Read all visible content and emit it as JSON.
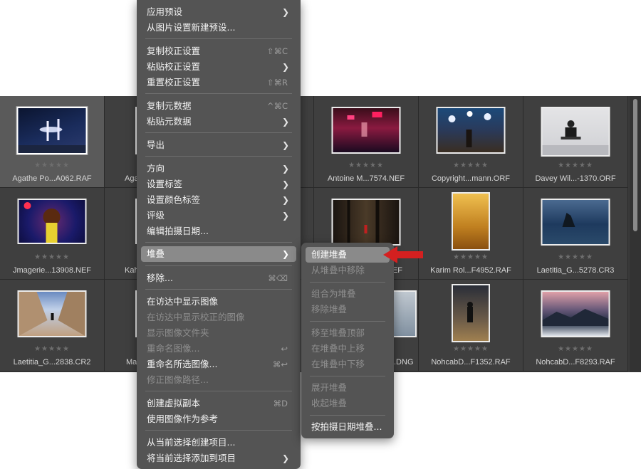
{
  "grid": [
    {
      "file": "Agathe Po...A062.RAF",
      "stars": "★★★★★",
      "selected": true
    },
    {
      "file": "Aga",
      "stars": "★★★★★",
      "selected": false
    },
    {
      "file": "F",
      "stars": "★★★★★",
      "selected": false
    },
    {
      "file": "Antoine M...7574.NEF",
      "stars": "★★★★★",
      "selected": false
    },
    {
      "file": "Copyright...mann.ORF",
      "stars": "★★★★★",
      "selected": false
    },
    {
      "file": "Davey Wil...-1370.ORF",
      "stars": "★★★★★",
      "selected": false
    },
    {
      "file": "Jmagerie...13908.NEF",
      "stars": "★★★★★",
      "selected": false
    },
    {
      "file": "Kah",
      "stars": "★★★★★",
      "selected": false
    },
    {
      "file": "",
      "stars": "★★★★★",
      "selected": false
    },
    {
      "file": "NEF",
      "stars": "★★★★★",
      "selected": false
    },
    {
      "file": "Karim Rol...F4952.RAF",
      "stars": "★★★★★",
      "selected": false
    },
    {
      "file": "Laetitia_G...5278.CR3",
      "stars": "★★★★★",
      "selected": false
    },
    {
      "file": "Laetitia_G...2838.CR2",
      "stars": "★★★★★",
      "selected": false
    },
    {
      "file": "Ma",
      "stars": "★★★★★",
      "selected": false
    },
    {
      "file": "",
      "stars": "★★★★★",
      "selected": false
    },
    {
      "file": ".DNG",
      "stars": "★★★★★",
      "selected": false
    },
    {
      "file": "NohcabD...F1352.RAF",
      "stars": "★★★★★",
      "selected": false
    },
    {
      "file": "NohcabD...F8293.RAF",
      "stars": "★★★★★",
      "selected": false
    }
  ],
  "context_menu": [
    {
      "label": "应用预设",
      "shortcut": "",
      "submenu": true,
      "disabled": false
    },
    {
      "label": "从图片设置新建预设...",
      "shortcut": "",
      "submenu": false,
      "disabled": false
    },
    {
      "label": "复制校正设置",
      "shortcut": "⇧⌘C",
      "submenu": false,
      "disabled": false
    },
    {
      "label": "粘贴校正设置",
      "shortcut": "",
      "submenu": true,
      "disabled": false
    },
    {
      "label": "重置校正设置",
      "shortcut": "⇧⌘R",
      "submenu": false,
      "disabled": false
    },
    {
      "label": "复制元数据",
      "shortcut": "^⌘C",
      "submenu": false,
      "disabled": false
    },
    {
      "label": "粘贴元数据",
      "shortcut": "",
      "submenu": true,
      "disabled": false
    },
    {
      "label": "导出",
      "shortcut": "",
      "submenu": true,
      "disabled": false
    },
    {
      "label": "方向",
      "shortcut": "",
      "submenu": true,
      "disabled": false
    },
    {
      "label": "设置标签",
      "shortcut": "",
      "submenu": true,
      "disabled": false
    },
    {
      "label": "设置颜色标签",
      "shortcut": "",
      "submenu": true,
      "disabled": false
    },
    {
      "label": "评级",
      "shortcut": "",
      "submenu": true,
      "disabled": false
    },
    {
      "label": "编辑拍摄日期...",
      "shortcut": "",
      "submenu": false,
      "disabled": false
    },
    {
      "label": "堆叠",
      "shortcut": "",
      "submenu": true,
      "disabled": false,
      "highlighted": true
    },
    {
      "label": "移除...",
      "shortcut": "⌘⌫",
      "submenu": false,
      "disabled": false
    },
    {
      "label": "在访达中显示图像",
      "shortcut": "",
      "submenu": false,
      "disabled": false
    },
    {
      "label": "在访达中显示校正的图像",
      "shortcut": "",
      "submenu": false,
      "disabled": true
    },
    {
      "label": "显示图像文件夹",
      "shortcut": "",
      "submenu": false,
      "disabled": true
    },
    {
      "label": "重命名图像...",
      "shortcut": "↩",
      "submenu": false,
      "disabled": true
    },
    {
      "label": "重命名所选图像...",
      "shortcut": "⌘↩",
      "submenu": false,
      "disabled": false
    },
    {
      "label": "修正图像路径...",
      "shortcut": "",
      "submenu": false,
      "disabled": true
    },
    {
      "label": "创建虚拟副本",
      "shortcut": "⌘D",
      "submenu": false,
      "disabled": false
    },
    {
      "label": "使用图像作为参考",
      "shortcut": "",
      "submenu": false,
      "disabled": false
    },
    {
      "label": "从当前选择创建项目...",
      "shortcut": "",
      "submenu": false,
      "disabled": false
    },
    {
      "label": "将当前选择添加到项目",
      "shortcut": "",
      "submenu": true,
      "disabled": false
    }
  ],
  "stack_submenu": [
    {
      "label": "创建堆叠",
      "disabled": false,
      "highlighted": true
    },
    {
      "label": "从堆叠中移除",
      "disabled": true
    },
    {
      "label": "组合为堆叠",
      "disabled": true
    },
    {
      "label": "移除堆叠",
      "disabled": true
    },
    {
      "label": "移至堆叠顶部",
      "disabled": true
    },
    {
      "label": "在堆叠中上移",
      "disabled": true
    },
    {
      "label": "在堆叠中下移",
      "disabled": true
    },
    {
      "label": "展开堆叠",
      "disabled": true
    },
    {
      "label": "收起堆叠",
      "disabled": true
    },
    {
      "label": "按拍摄日期堆叠...",
      "disabled": false
    }
  ],
  "colors": {
    "menu_bg": "#545454",
    "highlight": "#8a8a8a",
    "arrow": "#d42020",
    "grid_bg": "#3a3a3a"
  },
  "icons": {
    "submenu": "chevron-right-icon",
    "annotation": "red-arrow-icon"
  }
}
